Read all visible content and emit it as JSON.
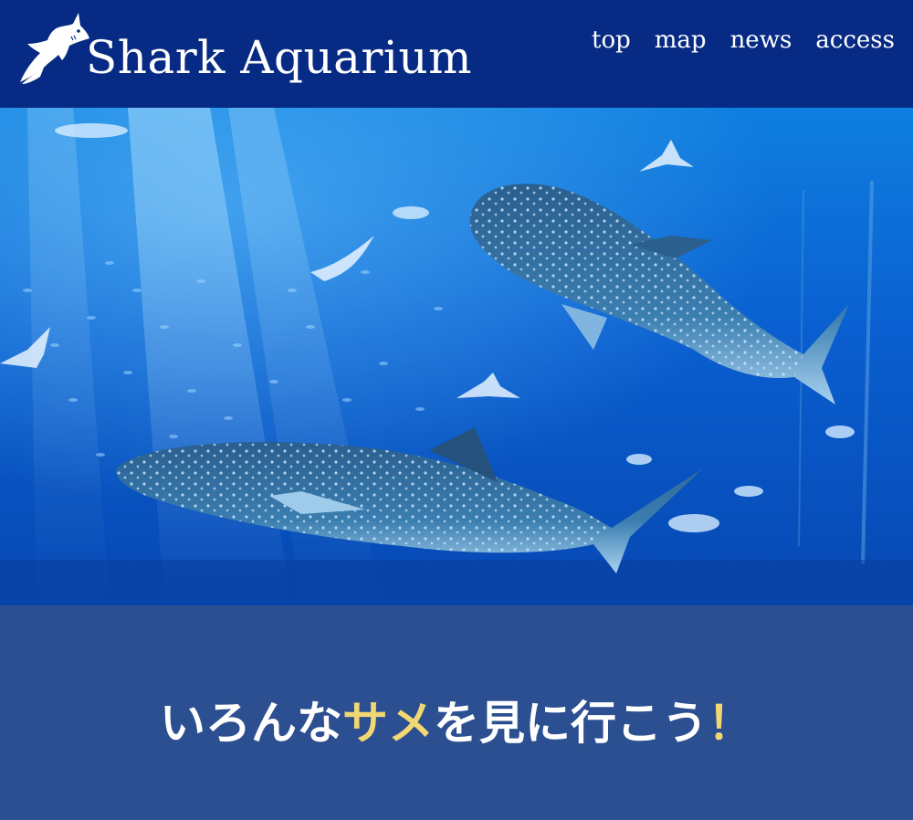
{
  "header": {
    "site_title": "Shark Aquarium",
    "logo_icon": "shark-logo-icon",
    "nav": [
      {
        "label": "top"
      },
      {
        "label": "map"
      },
      {
        "label": "news"
      },
      {
        "label": "access"
      }
    ]
  },
  "hero": {
    "image_subject": "aquarium tank with whale sharks, manta rays and schools of fish"
  },
  "tagline": {
    "part1": "いろんな",
    "highlight": "サメ",
    "part2": "を見に行こう",
    "exclamation": "！"
  },
  "colors": {
    "header_bg": "#072b84",
    "body_bg": "#2b4f91",
    "accent_yellow": "#f2d872",
    "text": "#ffffff"
  }
}
